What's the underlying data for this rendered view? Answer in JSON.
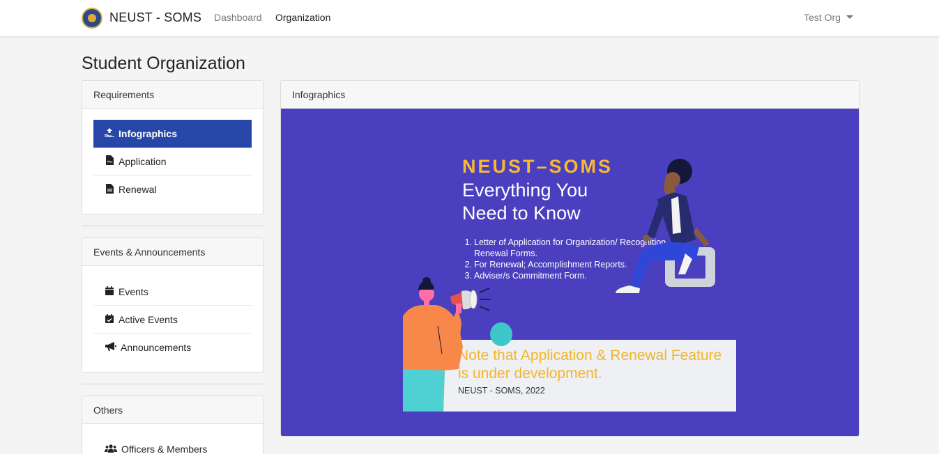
{
  "navbar": {
    "brand": "NEUST - SOMS",
    "links": [
      {
        "label": "Dashboard",
        "active": false
      },
      {
        "label": "Organization",
        "active": true
      }
    ],
    "user": "Test Org",
    "logo_icon": "seal-logo-icon"
  },
  "page": {
    "title": "Student Organization"
  },
  "sidebar": {
    "requirements": {
      "header": "Requirements",
      "items": [
        {
          "label": "Infographics",
          "icon": "hand-holding-up-arrow-icon",
          "active": true
        },
        {
          "label": "Application",
          "icon": "file-signature-icon"
        },
        {
          "label": "Renewal",
          "icon": "file-text-icon"
        }
      ]
    },
    "events": {
      "header": "Events & Announcements",
      "items": [
        {
          "label": "Events",
          "icon": "calendar-icon"
        },
        {
          "label": "Active Events",
          "icon": "calendar-check-icon"
        },
        {
          "label": "Announcements",
          "icon": "bullhorn-icon"
        }
      ]
    },
    "others": {
      "header": "Others",
      "items": [
        {
          "label": "Officers & Members",
          "icon": "users-icon"
        }
      ]
    }
  },
  "infographic": {
    "header": "Infographics",
    "title_brand": "NEUST–SOMS",
    "title_line1": "Everything You",
    "title_line2": "Need to Know",
    "list": [
      {
        "num": "1.",
        "text": "Letter of Application for Organization/ Recognition",
        "cont": "Renewal Forms."
      },
      {
        "num": "2.",
        "text": "For Renewal; Accomplishment Reports."
      },
      {
        "num": "3.",
        "text": "Adviser/s Commitment Form."
      }
    ],
    "note": "Note that Application & Renewal Feature is under development.",
    "note_sub": "NEUST - SOMS, 2022"
  },
  "colors": {
    "primary": "#2747a8",
    "poster_bg": "#4a3fbf",
    "accent_yellow": "#f7b932",
    "teal": "#3ec7c9"
  }
}
